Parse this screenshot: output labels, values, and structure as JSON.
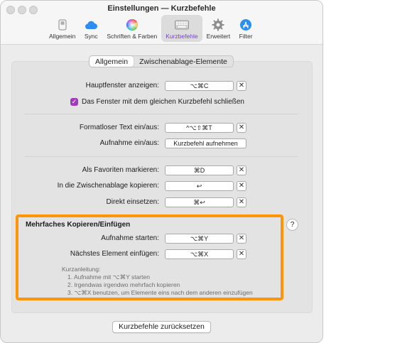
{
  "window": {
    "title": "Einstellungen — Kurzbefehle"
  },
  "toolbar": {
    "items": [
      {
        "label": "Allgemein",
        "icon": "switch-icon"
      },
      {
        "label": "Sync",
        "icon": "cloud-icon"
      },
      {
        "label": "Schriften & Farben",
        "icon": "color-wheel-icon"
      },
      {
        "label": "Kurzbefehle",
        "icon": "keyboard-icon",
        "active": true
      },
      {
        "label": "Erweitert",
        "icon": "gear-icon"
      },
      {
        "label": "Filter",
        "icon": "app-store-icon"
      }
    ],
    "active_color": "#7a3fd4"
  },
  "tabs": [
    "Allgemein",
    "Zwischenablage-Elemente"
  ],
  "shortcuts": {
    "main_window_label": "Hauptfenster anzeigen:",
    "main_window_value": "⌥⌘C",
    "close_same_label": "Das Fenster mit dem gleichen Kurzbefehl schließen",
    "plaintext_label": "Formatloser Text ein/aus:",
    "plaintext_value": "^⌥⇧⌘T",
    "recording_label": "Aufnahme ein/aus:",
    "recording_button": "Kurzbefehl aufnehmen",
    "favorite_label": "Als Favoriten markieren:",
    "favorite_value": "⌘D",
    "copy_label": "In die Zwischenablage kopieren:",
    "copy_value": "↩",
    "paste_label": "Direkt einsetzen:",
    "paste_value": "⌘↩"
  },
  "multi_copy": {
    "title": "Mehrfaches Kopieren/Einfügen",
    "start_label": "Aufnahme starten:",
    "start_value": "⌥⌘Y",
    "next_label": "Nächstes Element einfügen:",
    "next_value": "⌥⌘X",
    "instructions_title": "Kurzanleitung:",
    "steps": [
      "1. Aufnahme mit ⌥⌘Y starten",
      "2. Irgendwas irgendwo mehrfach kopieren",
      "3. ⌥⌘X benutzen, um Elemente eins nach dem anderen einzufügen"
    ],
    "highlight_color": "#ff9408"
  },
  "clear_symbol": "✕",
  "help_symbol": "?",
  "reset_button": "Kurzbefehle zurücksetzen",
  "checkbox_color": "#a23cbd"
}
